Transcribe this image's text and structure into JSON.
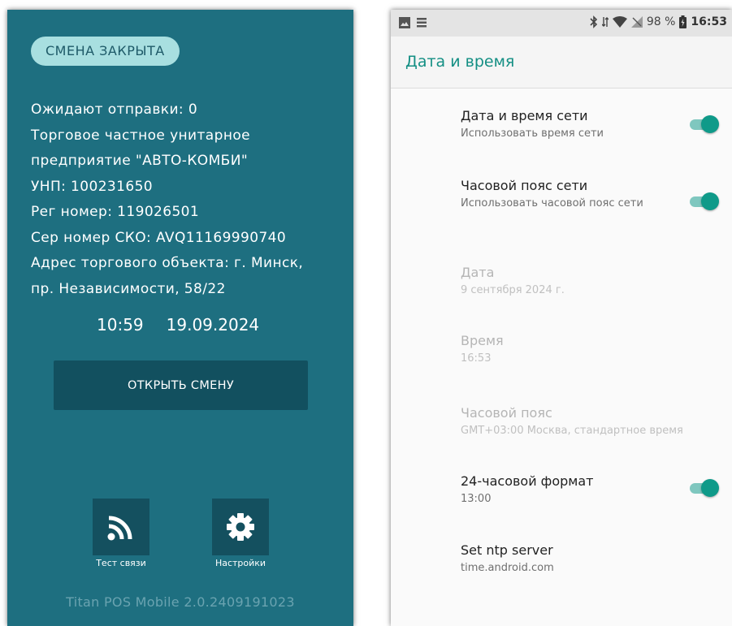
{
  "left": {
    "shift_status": "СМЕНА ЗАКРЫТА",
    "info_lines": [
      "Ожидают отправки: 0",
      "Торговое частное унитарное",
      "предприятие \"АВТО-КОМБИ\"",
      "УНП: 100231650",
      "Рег номер: 119026501",
      "Сер номер СКО: AVQ11169990740",
      "Адрес торгового объекта: г. Минск,",
      "пр. Независимости, 58/22"
    ],
    "time": "10:59",
    "date": "19.09.2024",
    "open_shift_label": "ОТКРЫТЬ СМЕНУ",
    "test_label": "Тест связи",
    "settings_label": "Настройки",
    "version": "Titan POS Mobile 2.0.2409191023",
    "icons": {
      "test": "wifi-signal-icon",
      "settings": "gear-icon"
    }
  },
  "right": {
    "status_bar": {
      "battery": "98 %",
      "time": "16:53"
    },
    "title": "Дата и время",
    "settings": [
      {
        "title": "Дата и время сети",
        "summary": "Использовать время сети",
        "toggle": true,
        "enabled": true
      },
      {
        "title": "Часовой пояс сети",
        "summary": "Использовать часовой пояс сети",
        "toggle": true,
        "enabled": true
      },
      {
        "title": "Дата",
        "summary": "9 сентября 2024 г.",
        "toggle": false,
        "enabled": false
      },
      {
        "title": "Время",
        "summary": "16:53",
        "toggle": false,
        "enabled": false
      },
      {
        "title": "Часовой пояс",
        "summary": "GMT+03:00 Москва, стандартное время",
        "toggle": false,
        "enabled": false
      },
      {
        "title": "24-часовой формат",
        "summary": "13:00",
        "toggle": true,
        "enabled": true
      },
      {
        "title": "Set ntp server",
        "summary": "time.android.com",
        "toggle": false,
        "enabled": true
      }
    ]
  },
  "colors": {
    "left_bg": "#1e6f80",
    "button_bg": "#12505f",
    "accent": "#148f84",
    "toggle_on": "#0f9a89"
  }
}
